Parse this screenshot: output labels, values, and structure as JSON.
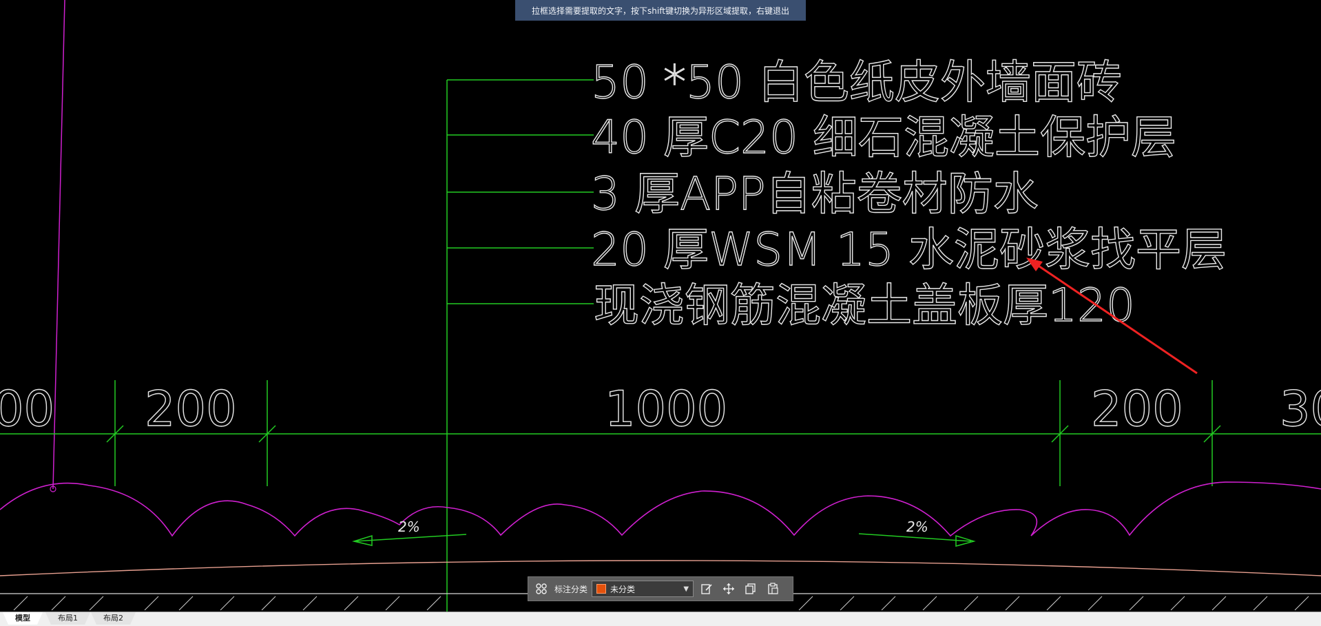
{
  "hint": {
    "text": "拉框选择需要提取的文字，按下shift键切换为异形区域提取，右键退出"
  },
  "drawing": {
    "notes": [
      "50 *50 白色纸皮外墙面砖",
      "40 厚C20 细石混凝土保护层",
      "3 厚APP自粘卷材防水",
      "20 厚WSM  15 水泥砂浆找平层",
      "现浇钢筋混凝土盖板厚120"
    ],
    "dimensions": [
      "00",
      "200",
      "1000",
      "200",
      "30"
    ],
    "slopes": [
      "2%",
      "2%"
    ]
  },
  "toolbar": {
    "category_label": "标注分类",
    "category_value": "未分类",
    "icons": [
      "grid-icon",
      "edit-icon",
      "move-icon",
      "copy-icon",
      "paste-icon"
    ]
  },
  "tabs": [
    {
      "label": "模型",
      "active": true
    },
    {
      "label": "布局1",
      "active": false
    },
    {
      "label": "布局2",
      "active": false
    }
  ],
  "colors": {
    "background": "#000000",
    "leader_green": "#22cc22",
    "arc_magenta": "#d020d0",
    "slab_line": "#e8a090",
    "annotation_arrow": "#ee2222",
    "text": "#e8e8e8"
  }
}
